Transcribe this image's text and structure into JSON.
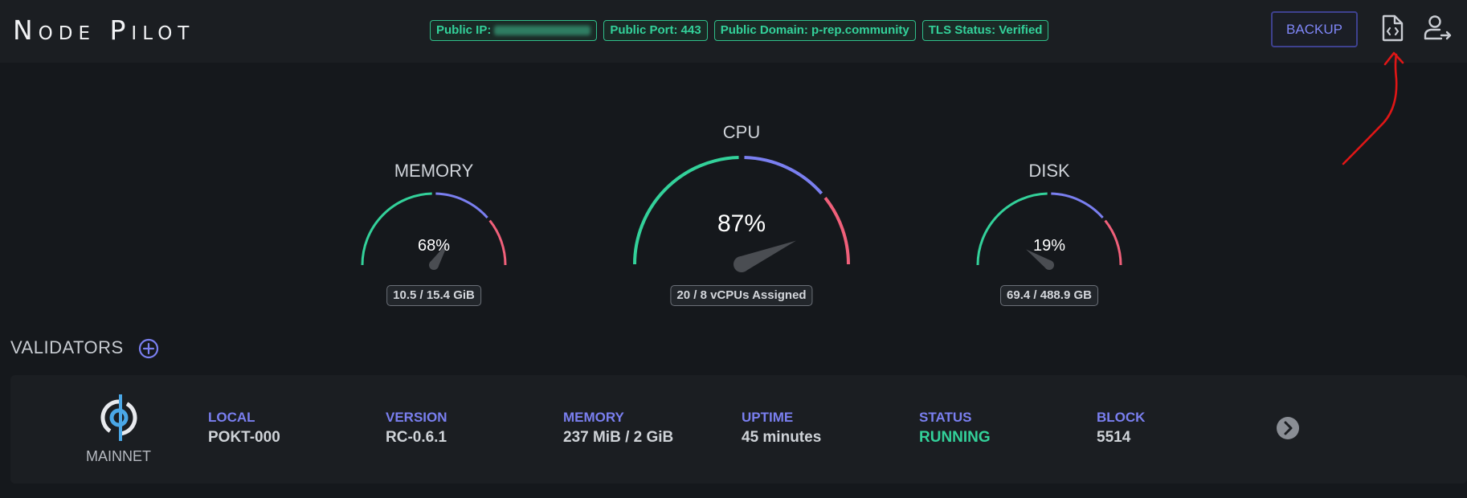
{
  "header": {
    "app_title": "Node Pilot",
    "badges": {
      "public_ip_label": "Public IP:",
      "public_port": "Public Port: 443",
      "public_domain": "Public Domain: p-rep.community",
      "tls_status": "TLS Status: Verified"
    },
    "backup_label": "BACKUP",
    "icons": [
      "code-file-icon",
      "user-logout-icon"
    ]
  },
  "gauges": {
    "memory": {
      "title": "MEMORY",
      "percent_text": "68%",
      "value": 68,
      "usage": "10.5 / 15.4 GiB"
    },
    "cpu": {
      "title": "CPU",
      "percent_text": "87%",
      "value": 87,
      "usage": "20 / 8 vCPUs Assigned"
    },
    "disk": {
      "title": "DISK",
      "percent_text": "19%",
      "value": 19,
      "usage": "69.4 / 488.9 GB"
    }
  },
  "validators": {
    "section_title": "VALIDATORS",
    "items": [
      {
        "network": "MAINNET",
        "columns": [
          {
            "label": "LOCAL",
            "value": "POKT-000"
          },
          {
            "label": "VERSION",
            "value": "RC-0.6.1"
          },
          {
            "label": "MEMORY",
            "value": "237 MiB / 2 GiB"
          },
          {
            "label": "UPTIME",
            "value": "45 minutes"
          },
          {
            "label": "STATUS",
            "value": "RUNNING"
          },
          {
            "label": "BLOCK",
            "value": "5514"
          }
        ]
      }
    ]
  },
  "colors": {
    "accent": "#7a7ff0",
    "success": "#33d19a",
    "danger": "#f0607a",
    "background": "#15181c"
  }
}
